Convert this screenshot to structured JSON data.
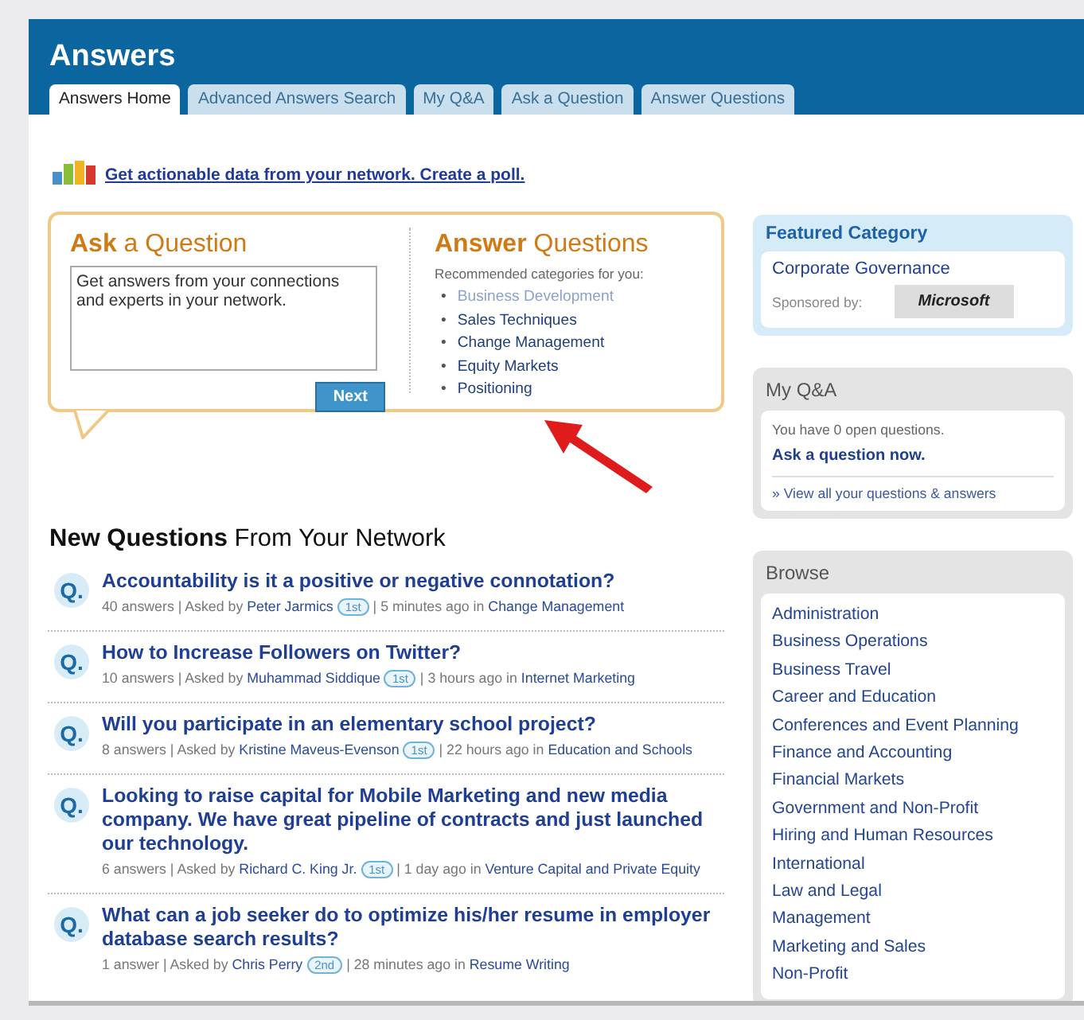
{
  "header": {
    "title": "Answers"
  },
  "tabs": [
    {
      "label": "Answers Home",
      "selected": true
    },
    {
      "label": "Advanced Answers Search",
      "selected": false
    },
    {
      "label": "My Q&A",
      "selected": false
    },
    {
      "label": "Ask a Question",
      "selected": false
    },
    {
      "label": "Answer Questions",
      "selected": false
    }
  ],
  "poll_link": "Get actionable data from your network. Create a poll.",
  "ask": {
    "title_strong": "Ask",
    "title_rest": "a Question",
    "placeholder": "Get answers from your connections and experts in your network.",
    "button": "Next"
  },
  "answer": {
    "title_strong": "Answer",
    "title_rest": "Questions",
    "subtitle": "Recommended categories for you:",
    "bullet": "•",
    "categories": [
      {
        "label": "Business Development",
        "visited": true
      },
      {
        "label": "Sales Techniques",
        "visited": false
      },
      {
        "label": "Change Management",
        "visited": false
      },
      {
        "label": "Equity Markets",
        "visited": false
      },
      {
        "label": "Positioning",
        "visited": false
      }
    ]
  },
  "questions_heading": {
    "strong": "New Questions",
    "rest": "From Your Network"
  },
  "questions": [
    {
      "icon": "Q.",
      "title": "Accountability is it a positive or negative connotation?",
      "answers": "40 answers |",
      "asked_by": "Asked by",
      "author": "Peter Jarmics",
      "degree": "1st",
      "time": "| 5 minutes ago in",
      "category": "Change Management"
    },
    {
      "icon": "Q.",
      "title": "How to Increase Followers on Twitter?",
      "answers": "10 answers |",
      "asked_by": "Asked by",
      "author": "Muhammad Siddique",
      "degree": "1st",
      "time": "| 3 hours ago in",
      "category": "Internet Marketing"
    },
    {
      "icon": "Q.",
      "title": "Will you participate in an elementary school project?",
      "answers": "8 answers |",
      "asked_by": "Asked by",
      "author": "Kristine Maveus-Evenson",
      "degree": "1st",
      "time": "| 22 hours ago in",
      "category": "Education and Schools"
    },
    {
      "icon": "Q.",
      "title": "Looking to raise capital for Mobile Marketing and new media company. We have great pipeline of contracts and just launched our technology.",
      "answers": "6 answers |",
      "asked_by": "Asked by",
      "author": "Richard C. King Jr.",
      "degree": "1st",
      "time": "| 1 day ago in",
      "category": "Venture Capital and Private Equity"
    },
    {
      "icon": "Q.",
      "title": "What can a job seeker do to optimize his/her resume in employer database search results?",
      "answers": "1 answer |",
      "asked_by": "Asked by",
      "author": "Chris Perry",
      "degree": "2nd",
      "time": "| 28 minutes ago in",
      "category": "Resume Writing"
    }
  ],
  "featured": {
    "heading": "Featured Category",
    "category": "Corporate Governance",
    "sponsored_by": "Sponsored by:",
    "sponsor_logo": "Microsoft"
  },
  "my_qa": {
    "heading": "My Q&A",
    "status": "You have 0 open questions.",
    "ask_link": "Ask a question now.",
    "view_all": "» View all your questions & answers"
  },
  "browse": {
    "heading": "Browse",
    "items": [
      "Administration",
      "Business Operations",
      "Business Travel",
      "Career and Education",
      "Conferences and Event Planning",
      "Finance and Accounting",
      "Financial Markets",
      "Government and Non-Profit",
      "Hiring and Human Resources",
      "International",
      "Law and Legal",
      "Management",
      "Marketing and Sales",
      "Non-Profit"
    ]
  }
}
